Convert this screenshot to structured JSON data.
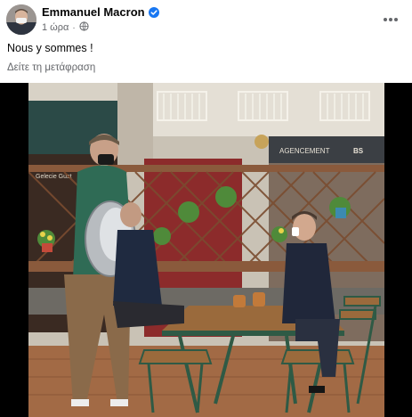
{
  "post": {
    "author": "Emmanuel Macron",
    "time": "1 ώρα",
    "caption": "Nous y sommes !",
    "translate_link": "Δείτε τη μετάφραση"
  },
  "photo": {
    "sign_left": "Gelecie Gust",
    "sign_right": "AGENCEMENT",
    "sign_right_logo": "BS"
  },
  "icons": {
    "verified": "verified-badge-icon",
    "audience": "globe-icon",
    "more": "more-options-icon"
  },
  "colors": {
    "link_blue": "#1877f2",
    "secondary_text": "#65676b"
  }
}
